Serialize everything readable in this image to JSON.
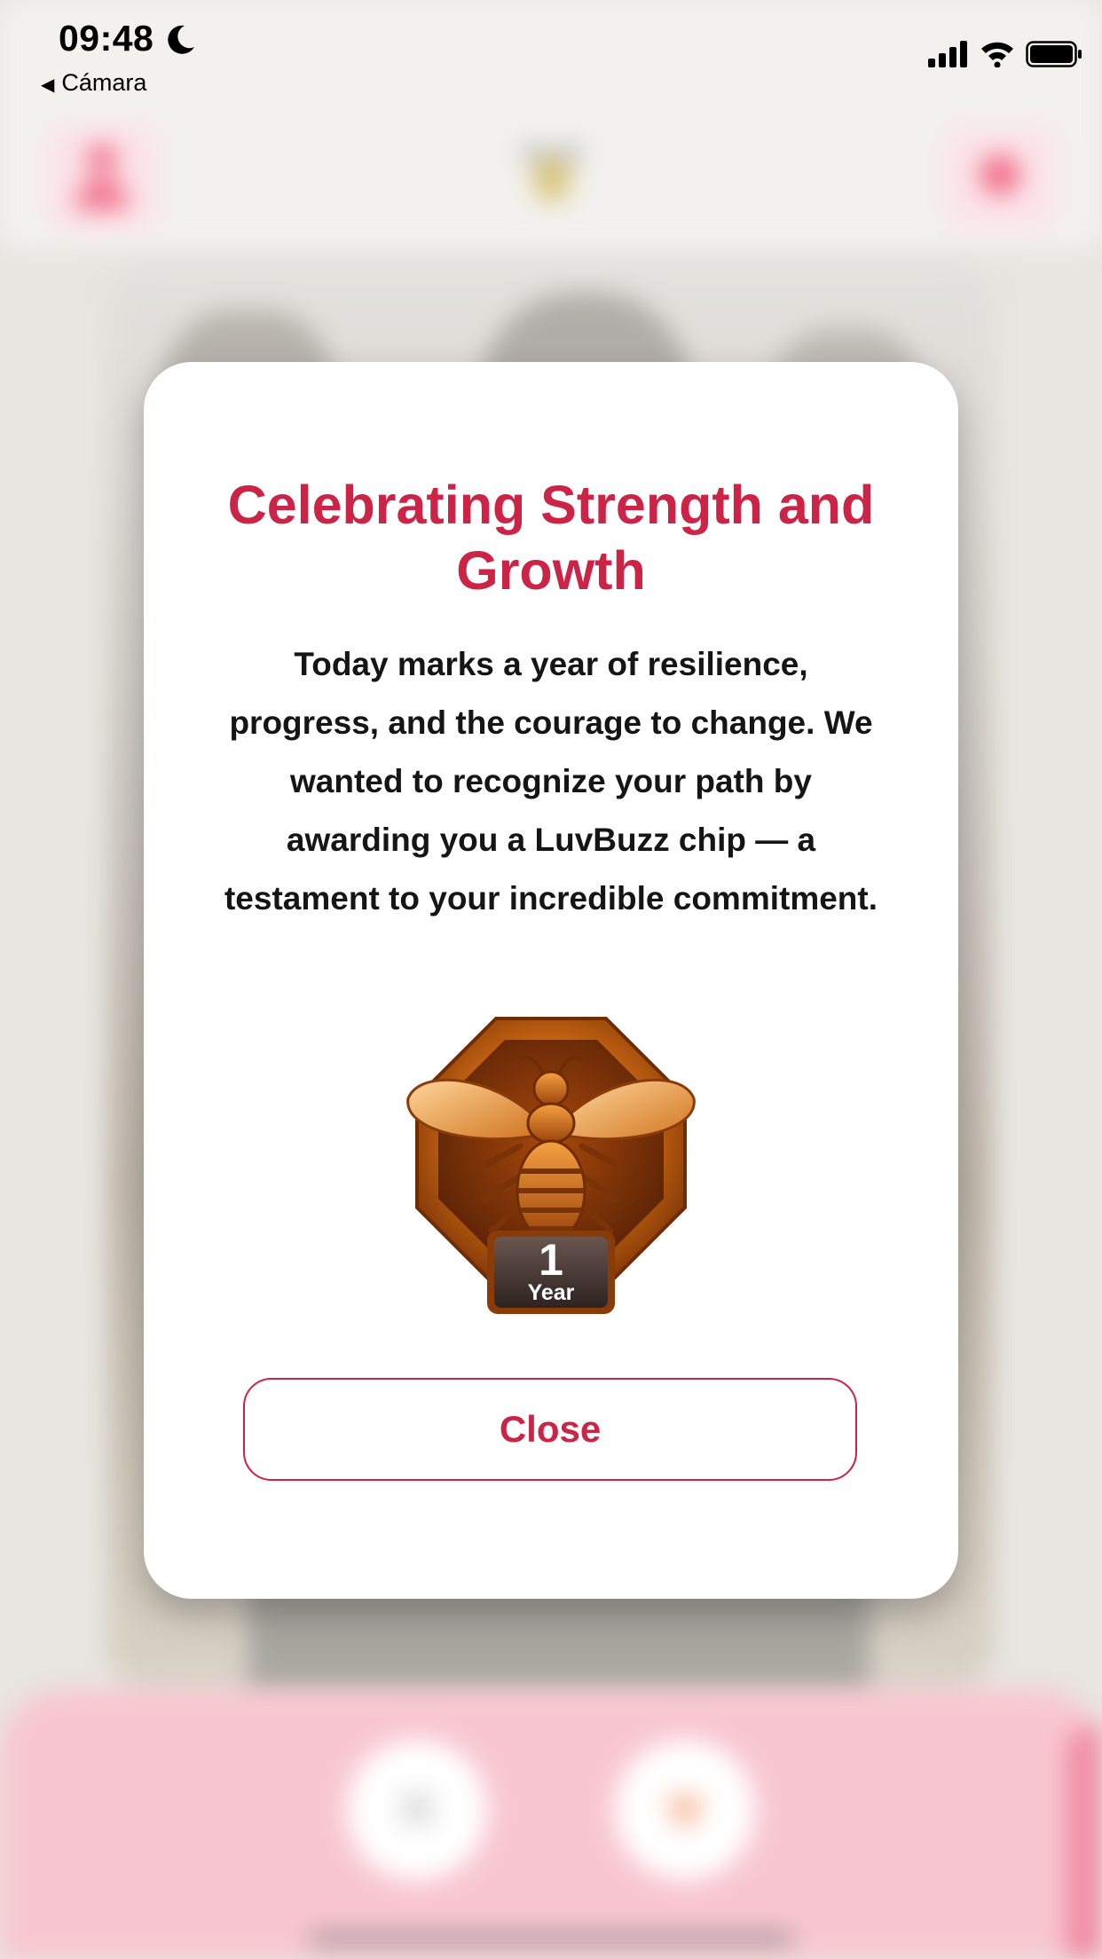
{
  "status_bar": {
    "time": "09:48",
    "back_label": "Cámara",
    "icons": [
      "moon-icon",
      "signal-icon",
      "wifi-icon",
      "battery-icon"
    ]
  },
  "background_app": {
    "buttons": [
      "profile-icon",
      "bee-logo",
      "chat-icon",
      "close-icon",
      "heart-icon"
    ],
    "dislike_glyph": "✕",
    "like_glyph": "♥"
  },
  "modal": {
    "title": "Celebrating Strength and Growth",
    "body": "Today marks a year of resilience, progress, and the courage to change. We wanted to recognize your path by awarding you a LuvBuzz chip — a testament to your incredible commitment.",
    "chip": {
      "number": "1",
      "unit": "Year"
    },
    "close_label": "Close"
  },
  "colors": {
    "accent": "#cc2447",
    "bottom_bar": "#f8c6d0"
  }
}
